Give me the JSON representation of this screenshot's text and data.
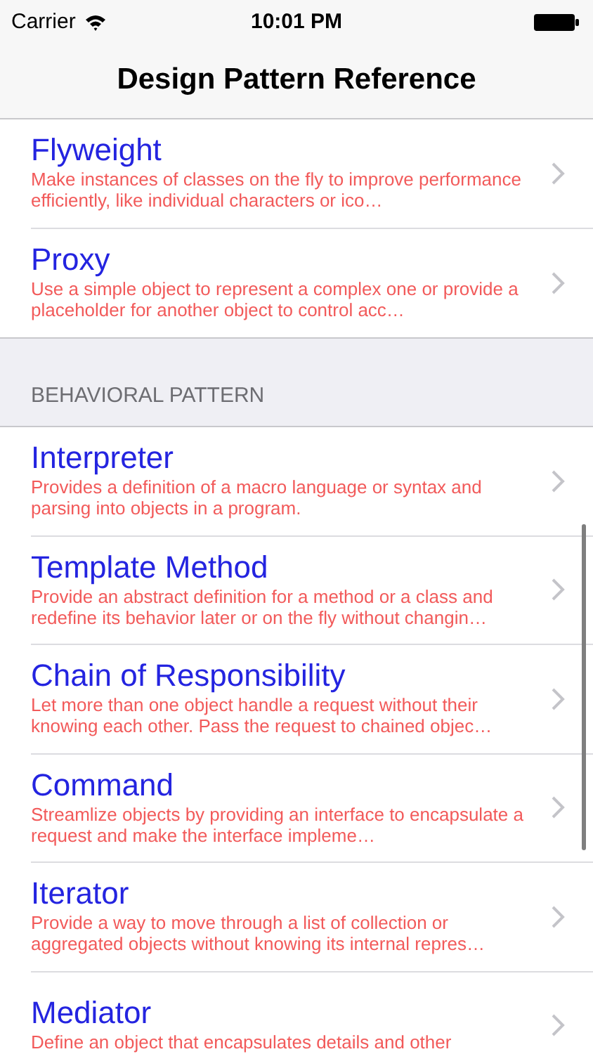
{
  "status_bar": {
    "carrier": "Carrier",
    "time": "10:01 PM"
  },
  "nav_bar": {
    "title": "Design Pattern Reference"
  },
  "sections": [
    {
      "rows": [
        {
          "title": "Flyweight",
          "description": "Make instances of classes on the fly to improve performance efficiently, like individual characters or ico…"
        },
        {
          "title": "Proxy",
          "description": "Use a simple object to represent a complex one or provide a placeholder for another object to control acc…"
        }
      ]
    },
    {
      "header": "BEHAVIORAL PATTERN",
      "rows": [
        {
          "title": "Interpreter",
          "description": "Provides a definition of a macro language or syntax and parsing into objects in a program."
        },
        {
          "title": "Template Method",
          "description": "Provide an abstract definition for a method or a class and redefine its behavior later or on the fly without changin…"
        },
        {
          "title": "Chain of Responsibility",
          "description": "Let more than one object handle a request without their knowing each other. Pass the request to chained objec…"
        },
        {
          "title": "Command",
          "description": "Streamlize objects by providing an interface to encapsulate a request and make the interface impleme…"
        },
        {
          "title": "Iterator",
          "description": "Provide a way to move through a list of collection or aggregated objects without knowing its internal repres…"
        },
        {
          "title": "Mediator",
          "description": "Define an object that encapsulates details and other"
        }
      ]
    }
  ]
}
